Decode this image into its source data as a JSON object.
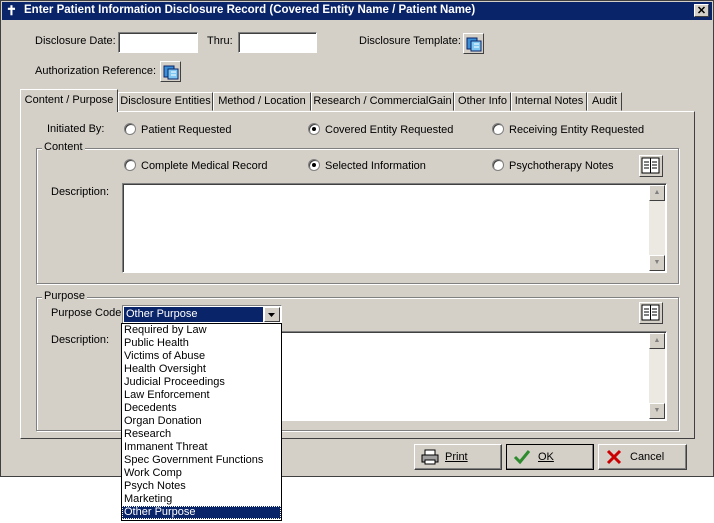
{
  "window": {
    "title": "Enter Patient Information Disclosure Record (Covered Entity Name / Patient Name)"
  },
  "header": {
    "disclosure_date_label": "Disclosure Date:",
    "disclosure_date_value": "",
    "thru_label": "Thru:",
    "thru_value": "",
    "template_label": "Disclosure Template:",
    "auth_ref_label": "Authorization Reference:"
  },
  "tabs": [
    {
      "label": "Content / Purpose",
      "active": true
    },
    {
      "label": "Disclosure Entities"
    },
    {
      "label": "Method / Location"
    },
    {
      "label": "Research / CommercialGain"
    },
    {
      "label": "Other Info"
    },
    {
      "label": "Internal Notes"
    },
    {
      "label": "Audit"
    }
  ],
  "initiated": {
    "label": "Initiated By:",
    "options": [
      "Patient Requested",
      "Covered Entity Requested",
      "Receiving Entity Requested"
    ],
    "selected": "Covered Entity Requested"
  },
  "content": {
    "group_title": "Content",
    "options": [
      "Complete Medical Record",
      "Selected Information",
      "Psychotherapy Notes"
    ],
    "selected": "Selected Information",
    "description_label": "Description:",
    "description_value": ""
  },
  "purpose": {
    "group_title": "Purpose",
    "code_label": "Purpose Code:",
    "code_value": "Other Purpose",
    "description_label": "Description:",
    "dropdown_options": [
      "Required by Law",
      "Public Health",
      "Victims of Abuse",
      "Health Oversight",
      "Judicial Proceedings",
      "Law Enforcement",
      "Decedents",
      "Organ Donation",
      "Research",
      "Immanent Threat",
      "Spec Government Functions",
      "Work Comp",
      "Psych Notes",
      "Marketing",
      "Other Purpose"
    ],
    "dropdown_selected": "Other Purpose"
  },
  "buttons": {
    "print": "Print",
    "ok": "OK",
    "cancel": "Cancel"
  },
  "colors": {
    "titlebar": "#0a246a",
    "face": "#d4d0c8",
    "ok_check": "#2e8b2e",
    "cancel_x": "#cc0000"
  },
  "icons": [
    "app-icon",
    "close-icon",
    "template-picker-icon",
    "authorization-picker-icon",
    "notes-icon",
    "printer-icon",
    "check-icon",
    "x-icon"
  ]
}
